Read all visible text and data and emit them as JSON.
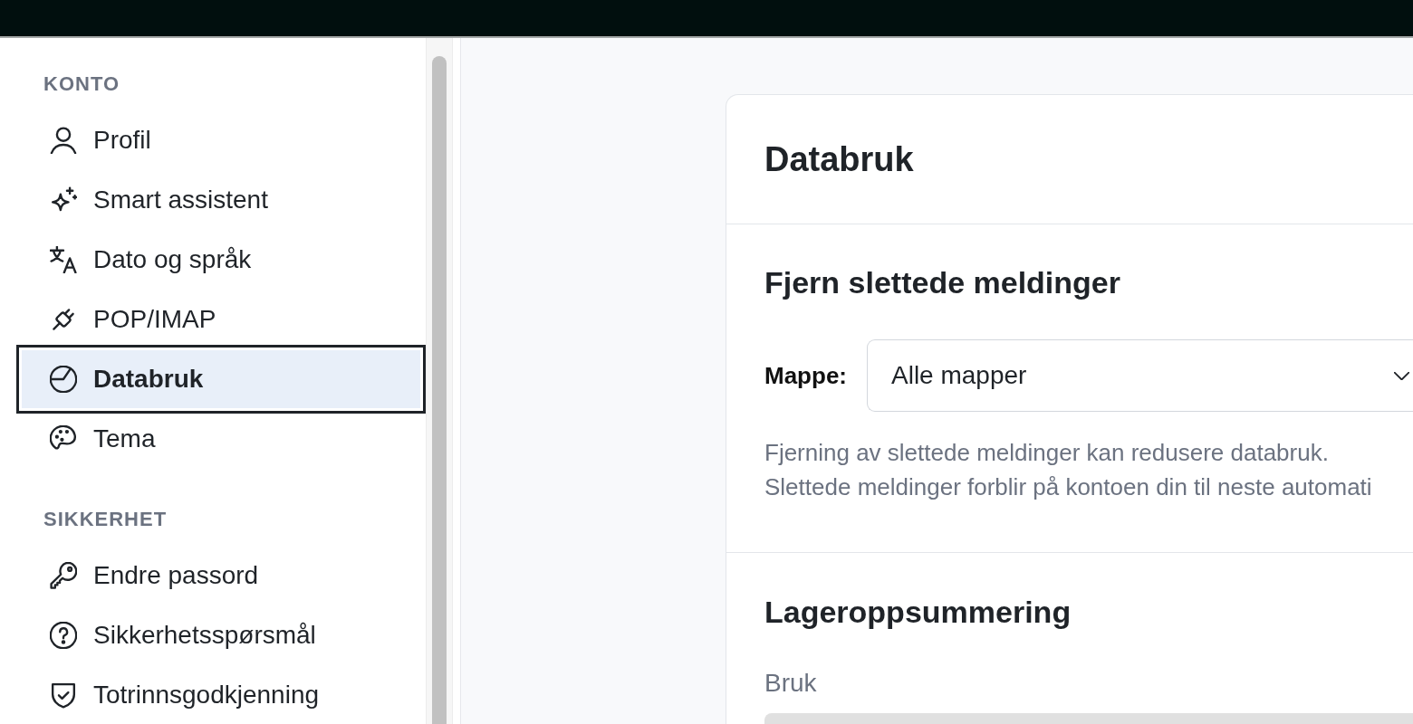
{
  "sidebar": {
    "sections": [
      {
        "heading": "KONTO",
        "items": [
          {
            "label": "Profil",
            "selected": false,
            "focused": false
          },
          {
            "label": "Smart assistent",
            "selected": false,
            "focused": false
          },
          {
            "label": "Dato og språk",
            "selected": false,
            "focused": false
          },
          {
            "label": "POP/IMAP",
            "selected": false,
            "focused": false
          },
          {
            "label": "Databruk",
            "selected": true,
            "focused": true
          },
          {
            "label": "Tema",
            "selected": false,
            "focused": false
          }
        ]
      },
      {
        "heading": "SIKKERHET",
        "items": [
          {
            "label": "Endre passord",
            "selected": false,
            "focused": false
          },
          {
            "label": "Sikkerhetsspørsmål",
            "selected": false,
            "focused": false
          },
          {
            "label": "Totrinnsgodkjenning",
            "selected": false,
            "focused": false
          }
        ]
      }
    ]
  },
  "card": {
    "title": "Databruk",
    "remove_deleted": {
      "heading": "Fjern slettede meldinger",
      "folder_label": "Mappe:",
      "folder_value": "Alle mapper",
      "help_lines": [
        "Fjerning av slettede meldinger kan redusere databruk.",
        "Slettede meldinger forblir på kontoen din til neste automati"
      ]
    },
    "storage_summary": {
      "heading": "Lageroppsummering",
      "usage_label": "Bruk"
    }
  }
}
